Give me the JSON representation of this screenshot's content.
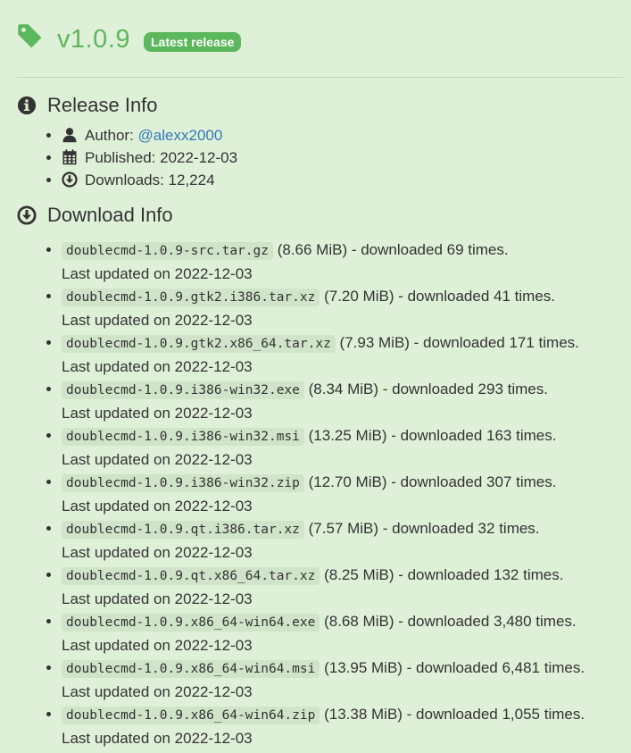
{
  "header": {
    "version": "v1.0.9",
    "badge": "Latest release",
    "tag_icon": "tag-icon"
  },
  "release_info": {
    "title": "Release Info",
    "icon": "info-circle-icon",
    "author_label": "Author: ",
    "author": "@alexx2000",
    "published": "Published: 2022-12-03",
    "downloads": "Downloads: 12,224"
  },
  "download_info": {
    "title": "Download Info",
    "icon": "download-circle-icon",
    "files": [
      {
        "name": "doublecmd-1.0.9-src.tar.gz",
        "details": " (8.66 MiB) - downloaded 69 times.",
        "updated": "Last updated on 2022-12-03"
      },
      {
        "name": "doublecmd-1.0.9.gtk2.i386.tar.xz",
        "details": " (7.20 MiB) - downloaded 41 times.",
        "updated": "Last updated on 2022-12-03"
      },
      {
        "name": "doublecmd-1.0.9.gtk2.x86_64.tar.xz",
        "details": " (7.93 MiB) - downloaded 171 times.",
        "updated": "Last updated on 2022-12-03"
      },
      {
        "name": "doublecmd-1.0.9.i386-win32.exe",
        "details": " (8.34 MiB) - downloaded 293 times.",
        "updated": "Last updated on 2022-12-03"
      },
      {
        "name": "doublecmd-1.0.9.i386-win32.msi",
        "details": " (13.25 MiB) - downloaded 163 times.",
        "updated": "Last updated on 2022-12-03"
      },
      {
        "name": "doublecmd-1.0.9.i386-win32.zip",
        "details": " (12.70 MiB) - downloaded 307 times.",
        "updated": "Last updated on 2022-12-03"
      },
      {
        "name": "doublecmd-1.0.9.qt.i386.tar.xz",
        "details": " (7.57 MiB) - downloaded 32 times.",
        "updated": "Last updated on 2022-12-03"
      },
      {
        "name": "doublecmd-1.0.9.qt.x86_64.tar.xz",
        "details": " (8.25 MiB) - downloaded 132 times.",
        "updated": "Last updated on 2022-12-03"
      },
      {
        "name": "doublecmd-1.0.9.x86_64-win64.exe",
        "details": " (8.68 MiB) - downloaded 3,480 times.",
        "updated": "Last updated on 2022-12-03"
      },
      {
        "name": "doublecmd-1.0.9.x86_64-win64.msi",
        "details": " (13.95 MiB) - downloaded 6,481 times.",
        "updated": "Last updated on 2022-12-03"
      },
      {
        "name": "doublecmd-1.0.9.x86_64-win64.zip",
        "details": " (13.38 MiB) - downloaded 1,055 times.",
        "updated": "Last updated on 2022-12-03"
      }
    ]
  },
  "colors": {
    "background": "#dff0d8",
    "accent_green": "#5cb85c",
    "link_blue": "#337ab7",
    "text": "#333333"
  }
}
